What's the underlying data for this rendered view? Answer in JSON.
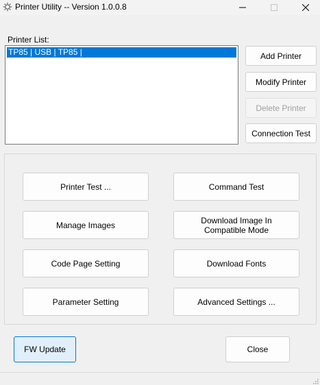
{
  "window": {
    "title": "Printer Utility -- Version 1.0.0.8",
    "icon": "gear-icon"
  },
  "printer_list": {
    "label": "Printer List:",
    "items": [
      "TP85 | USB | TP85 |"
    ]
  },
  "side_buttons": {
    "add": "Add Printer",
    "modify": "Modify Printer",
    "delete": "Delete Printer",
    "connection_test": "Connection Test"
  },
  "functions": {
    "printer_test": "Printer Test ...",
    "command_test": "Command Test",
    "manage_images": "Manage Images",
    "download_image_line1": "Download Image In",
    "download_image_line2": "Compatible Mode",
    "code_page": "Code Page Setting",
    "download_fonts": "Download Fonts",
    "parameter_setting": "Parameter Setting",
    "advanced_settings": "Advanced Settings ..."
  },
  "footer": {
    "fw_update": "FW Update",
    "close": "Close"
  },
  "colors": {
    "selection": "#0078d7",
    "primary_button_bg": "#e1effb",
    "window_bg": "#f0f0f0"
  }
}
